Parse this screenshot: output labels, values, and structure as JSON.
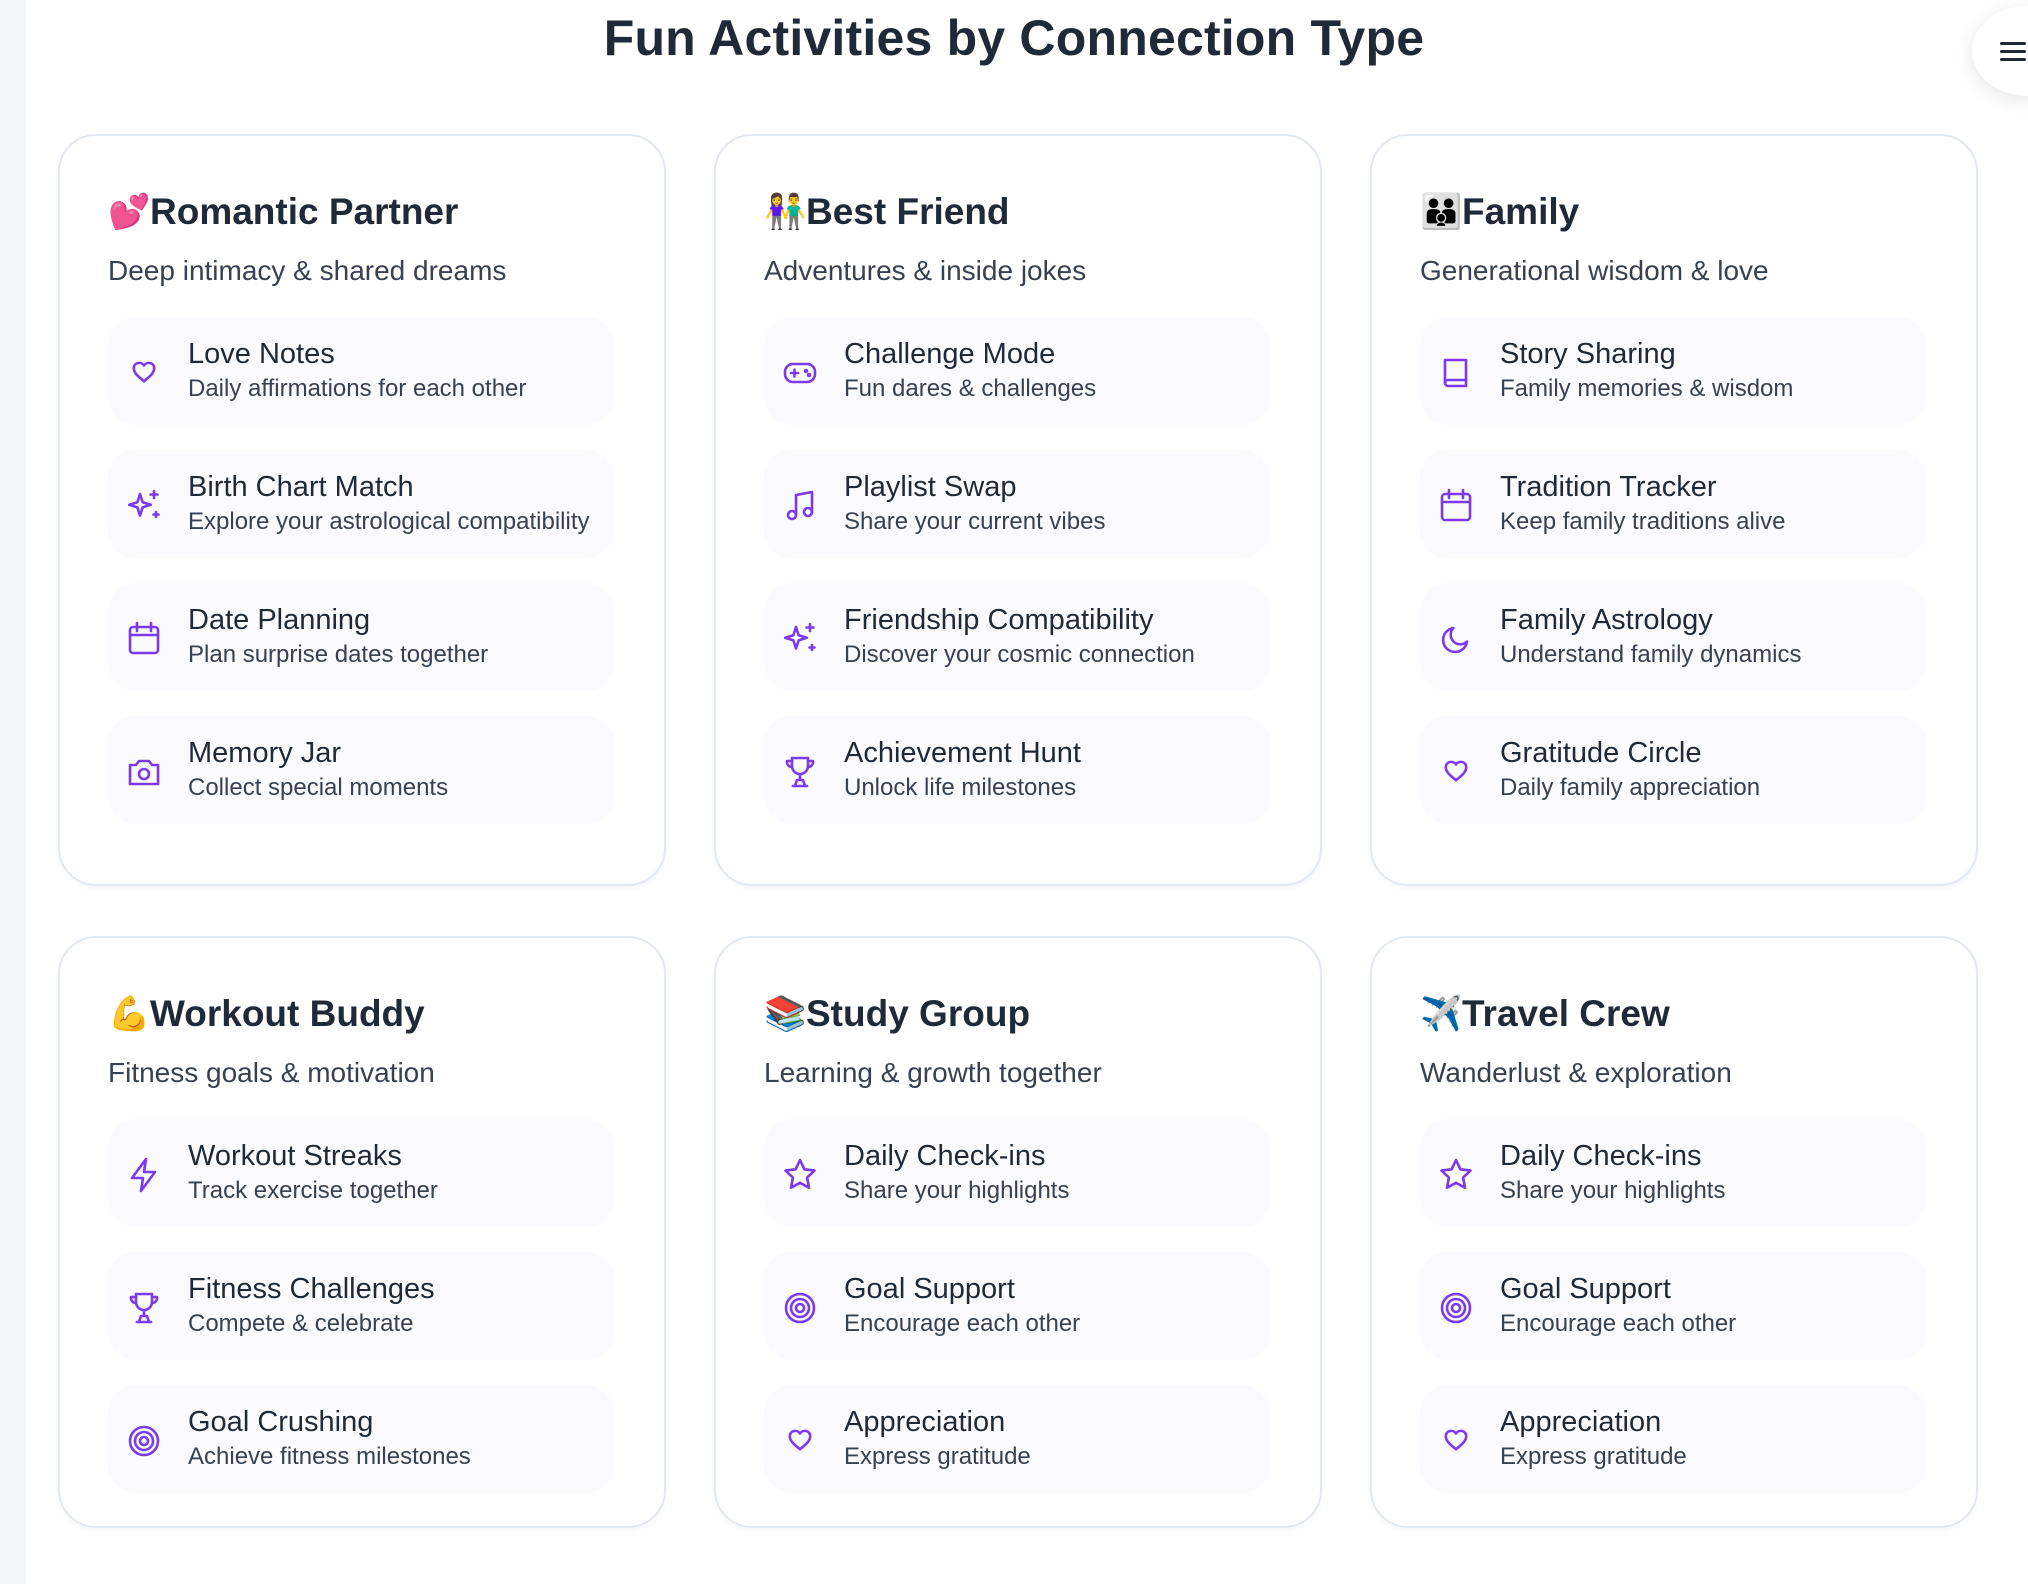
{
  "page": {
    "title": "Fun Activities by Connection Type"
  },
  "cards": [
    {
      "emoji": "💕",
      "title": "Romantic Partner",
      "subtitle": "Deep intimacy & shared dreams",
      "items": [
        {
          "icon": "heart-icon",
          "title": "Love Notes",
          "desc": "Daily affirmations for each other"
        },
        {
          "icon": "sparkles-icon",
          "title": "Birth Chart Match",
          "desc": "Explore your astrological compatibility"
        },
        {
          "icon": "calendar-icon",
          "title": "Date Planning",
          "desc": "Plan surprise dates together"
        },
        {
          "icon": "camera-icon",
          "title": "Memory Jar",
          "desc": "Collect special moments"
        }
      ]
    },
    {
      "emoji": "👫",
      "title": "Best Friend",
      "subtitle": "Adventures & inside jokes",
      "items": [
        {
          "icon": "gamepad-icon",
          "title": "Challenge Mode",
          "desc": "Fun dares & challenges"
        },
        {
          "icon": "music-icon",
          "title": "Playlist Swap",
          "desc": "Share your current vibes"
        },
        {
          "icon": "sparkles-icon",
          "title": "Friendship Compatibility",
          "desc": "Discover your cosmic connection"
        },
        {
          "icon": "trophy-icon",
          "title": "Achievement Hunt",
          "desc": "Unlock life milestones"
        }
      ]
    },
    {
      "emoji": "👪",
      "title": "Family",
      "subtitle": "Generational wisdom & love",
      "items": [
        {
          "icon": "book-icon",
          "title": "Story Sharing",
          "desc": "Family memories & wisdom"
        },
        {
          "icon": "calendar-icon",
          "title": "Tradition Tracker",
          "desc": "Keep family traditions alive"
        },
        {
          "icon": "moon-icon",
          "title": "Family Astrology",
          "desc": "Understand family dynamics"
        },
        {
          "icon": "heart-icon",
          "title": "Gratitude Circle",
          "desc": "Daily family appreciation"
        }
      ]
    },
    {
      "emoji": "💪",
      "title": "Workout Buddy",
      "subtitle": "Fitness goals & motivation",
      "items": [
        {
          "icon": "zap-icon",
          "title": "Workout Streaks",
          "desc": "Track exercise together"
        },
        {
          "icon": "trophy-icon",
          "title": "Fitness Challenges",
          "desc": "Compete & celebrate"
        },
        {
          "icon": "target-icon",
          "title": "Goal Crushing",
          "desc": "Achieve fitness milestones"
        }
      ]
    },
    {
      "emoji": "📚",
      "title": "Study Group",
      "subtitle": "Learning & growth together",
      "items": [
        {
          "icon": "star-icon",
          "title": "Daily Check-ins",
          "desc": "Share your highlights"
        },
        {
          "icon": "target-icon",
          "title": "Goal Support",
          "desc": "Encourage each other"
        },
        {
          "icon": "heart-icon",
          "title": "Appreciation",
          "desc": "Express gratitude"
        }
      ]
    },
    {
      "emoji": "✈️",
      "title": "Travel Crew",
      "subtitle": "Wanderlust & exploration",
      "items": [
        {
          "icon": "star-icon",
          "title": "Daily Check-ins",
          "desc": "Share your highlights"
        },
        {
          "icon": "target-icon",
          "title": "Goal Support",
          "desc": "Encourage each other"
        },
        {
          "icon": "heart-icon",
          "title": "Appreciation",
          "desc": "Express gratitude"
        }
      ]
    }
  ],
  "colors": {
    "accent": "#7c3aed",
    "card_border": "#e2e8f0",
    "item_bg": "#fbfaff"
  }
}
